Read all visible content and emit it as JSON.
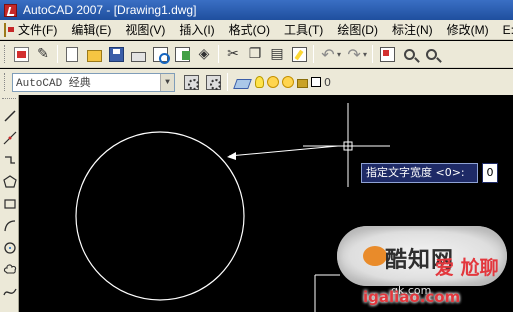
{
  "window": {
    "title": "AutoCAD 2007 - [Drawing1.dwg]"
  },
  "menu": {
    "items": [
      "文件(F)",
      "编辑(E)",
      "视图(V)",
      "插入(I)",
      "格式(O)",
      "工具(T)",
      "绘图(D)",
      "标注(N)",
      "修改(M)",
      "E:"
    ]
  },
  "toolbar": {
    "workspace_value": "AutoCAD 经典",
    "layer_current": "0"
  },
  "command": {
    "prompt": "指定文字宽度 <0>:",
    "input_value": "0"
  },
  "watermark": {
    "text": "酷知网",
    "brand": "爱 尬聊",
    "url": "igaliao.com",
    "url2": "qk.com"
  }
}
